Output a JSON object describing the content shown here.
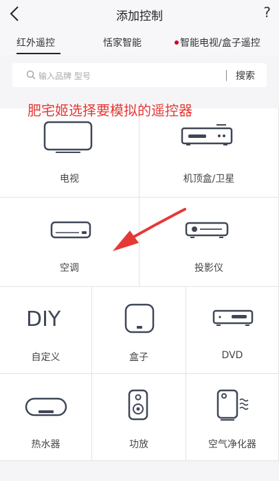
{
  "header": {
    "title": "添加控制",
    "help": "?"
  },
  "tabs": [
    {
      "label": "红外遥控",
      "active": true
    },
    {
      "label": "恬家智能",
      "active": false
    },
    {
      "label": "智能电视/盒子遥控",
      "active": false
    }
  ],
  "search": {
    "placeholder": "输入品牌 型号",
    "button": "搜索"
  },
  "annotation": "肥宅姬选择要模拟的遥控器",
  "devices": {
    "tv": "电视",
    "stb": "机顶盒/卫星",
    "ac": "空调",
    "projector": "投影仪",
    "diy": "自定义",
    "diy_icon_text": "DIY",
    "box": "盒子",
    "dvd": "DVD",
    "water_heater": "热水器",
    "amplifier": "功放",
    "air_purifier": "空气净化器"
  },
  "colors": {
    "accent_red": "#d0021b",
    "annotation_red": "#e53935",
    "icon_gray": "#3f4657"
  }
}
